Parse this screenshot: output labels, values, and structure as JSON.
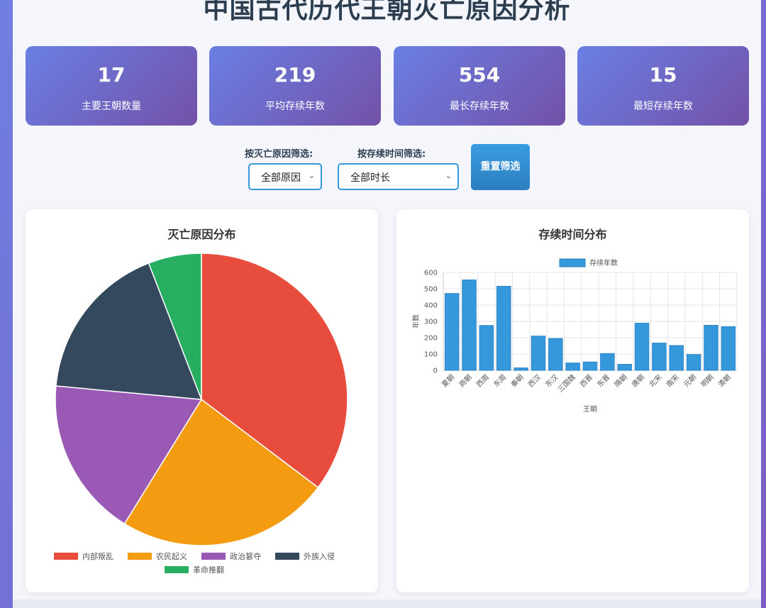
{
  "page": {
    "title": "中国古代历代王朝灭亡原因分析"
  },
  "stats": [
    {
      "value": "17",
      "label": "主要王朝数量"
    },
    {
      "value": "219",
      "label": "平均存续年数"
    },
    {
      "value": "554",
      "label": "最长存续年数"
    },
    {
      "value": "15",
      "label": "最短存续年数"
    }
  ],
  "filters": {
    "reason_label": "按灭亡原因筛选:",
    "reason_value": "全部原因",
    "duration_label": "按存续时间筛选:",
    "duration_value": "全部时长",
    "reset_label": "重置筛选"
  },
  "chart_data": [
    {
      "type": "pie",
      "title": "灭亡原因分布",
      "categories": [
        "内部叛乱",
        "农民起义",
        "政治篡夺",
        "外族入侵",
        "革命推翻"
      ],
      "values": [
        6,
        4,
        3,
        3,
        1
      ],
      "colors": [
        "#e74c3c",
        "#f39c12",
        "#9b59b6",
        "#34495e",
        "#27ae60"
      ],
      "legend": "bottom"
    },
    {
      "type": "bar",
      "title": "存续时间分布",
      "categories": [
        "夏朝",
        "商朝",
        "西周",
        "东周",
        "秦朝",
        "西汉",
        "东汉",
        "三国魏",
        "西晋",
        "东晋",
        "隋朝",
        "唐朝",
        "北宋",
        "南宋",
        "元朝",
        "明朝",
        "清朝"
      ],
      "series": [
        {
          "name": "存续年数",
          "values": [
            471,
            554,
            275,
            515,
            15,
            210,
            195,
            45,
            51,
            103,
            37,
            289,
            167,
            152,
            97,
            276,
            268
          ],
          "color": "#3498db"
        }
      ],
      "xlabel": "王朝",
      "ylabel": "年数",
      "ylim": [
        0,
        600
      ],
      "yticks": [
        0,
        100,
        200,
        300,
        400,
        500,
        600
      ],
      "grid": true,
      "legend": "top"
    }
  ]
}
